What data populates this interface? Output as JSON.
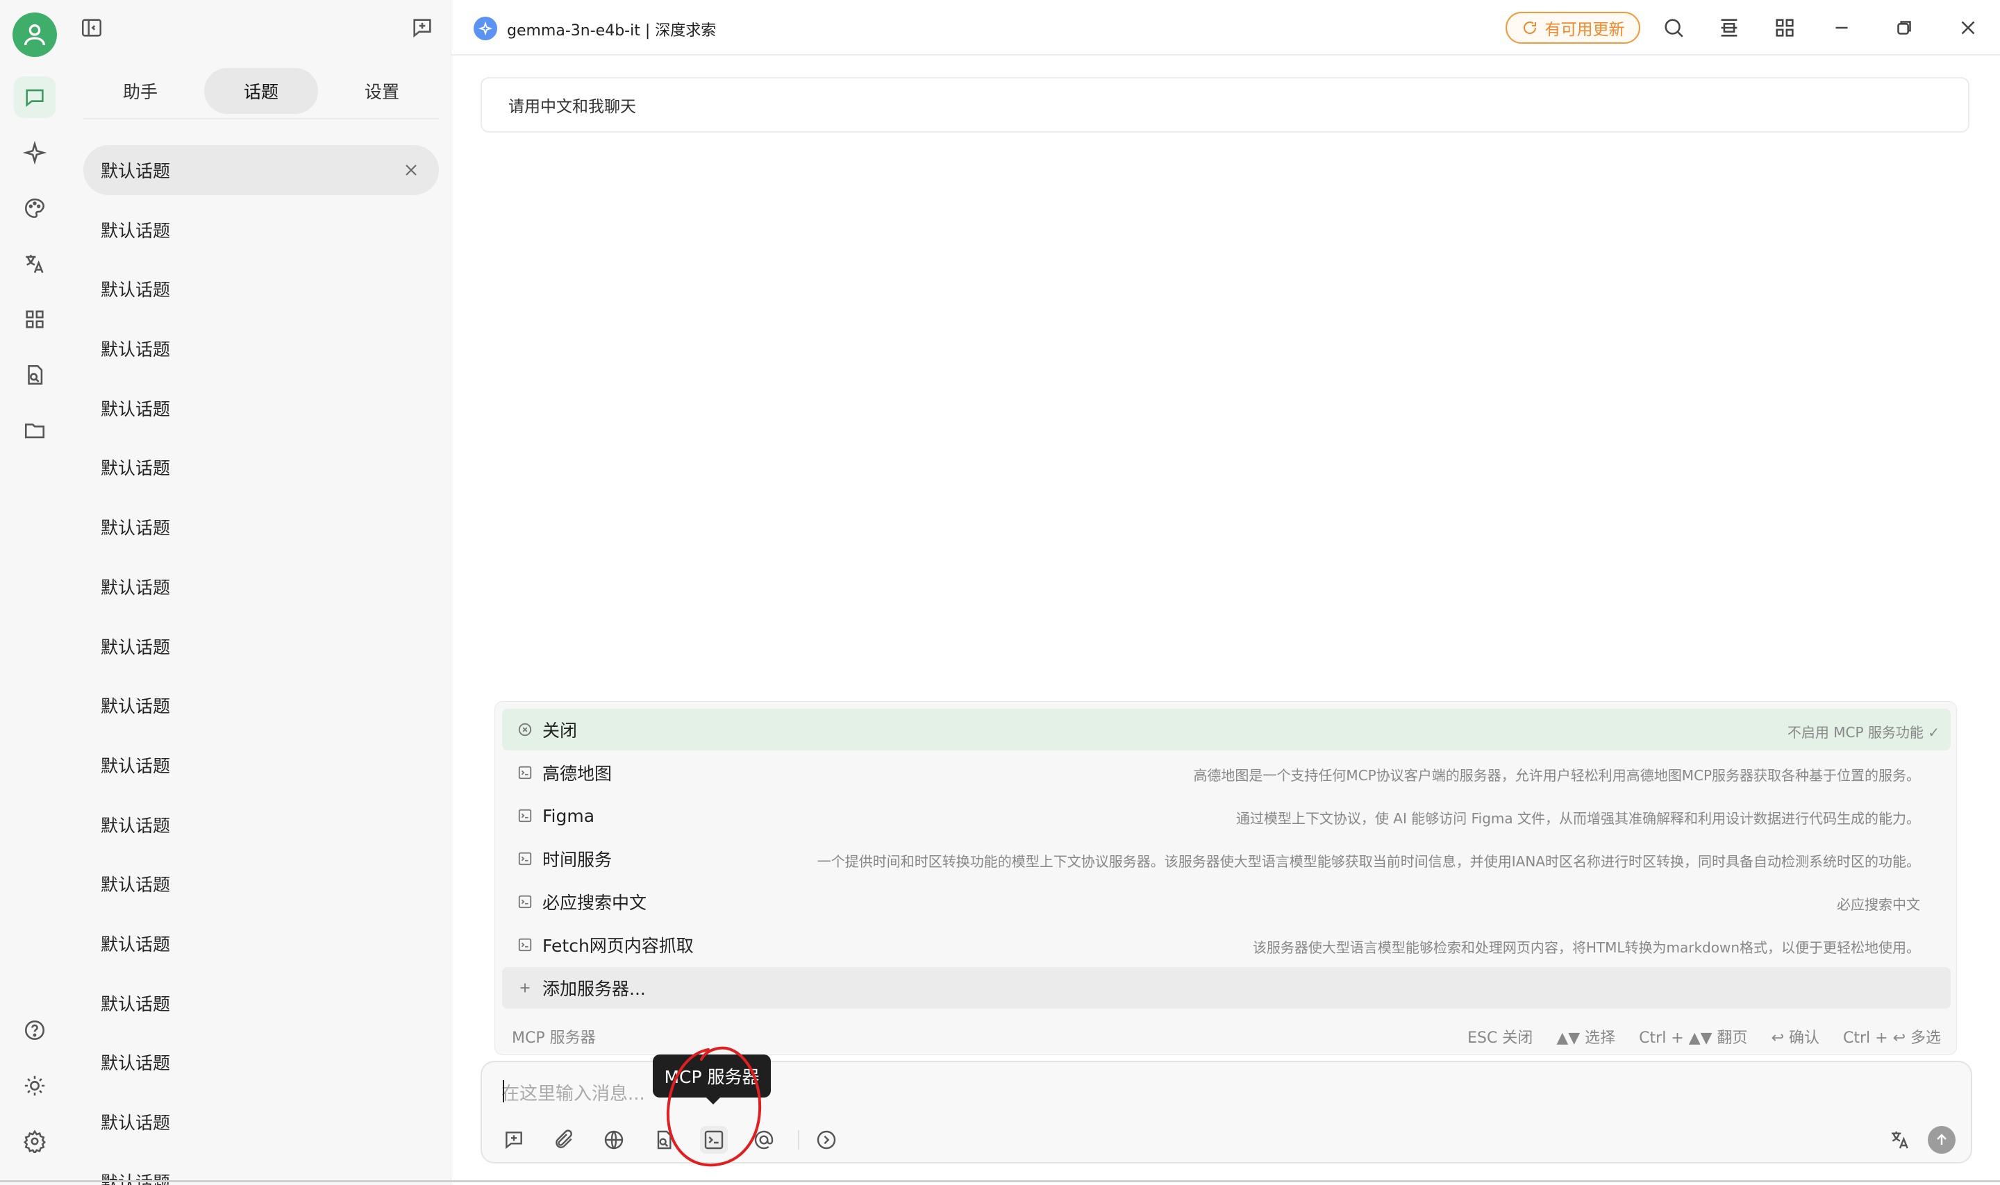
{
  "activity_bar": {
    "items": [
      {
        "icon": "chat-icon",
        "active": true
      },
      {
        "icon": "sparkle-icon"
      },
      {
        "icon": "palette-icon"
      },
      {
        "icon": "translate-icon"
      },
      {
        "icon": "apps-grid-icon"
      },
      {
        "icon": "file-search-icon"
      },
      {
        "icon": "folder-icon"
      }
    ],
    "bottom_items": [
      {
        "icon": "help-icon"
      },
      {
        "icon": "theme-icon"
      },
      {
        "icon": "settings-icon"
      }
    ]
  },
  "sidebar": {
    "tabs": [
      {
        "label": "助手"
      },
      {
        "label": "话题",
        "active": true
      },
      {
        "label": "设置"
      }
    ],
    "topics": [
      "默认话题",
      "默认话题",
      "默认话题",
      "默认话题",
      "默认话题",
      "默认话题",
      "默认话题",
      "默认话题",
      "默认话题",
      "默认话题",
      "默认话题",
      "默认话题",
      "默认话题",
      "默认话题",
      "默认话题",
      "默认话题",
      "默认话题",
      "默认话题"
    ]
  },
  "titlebar": {
    "model_name": "gemma-3n-e4b-it | 深度求索",
    "update_label": "有可用更新"
  },
  "main": {
    "system_prompt": "请用中文和我聊天"
  },
  "mcp_panel": {
    "title": "MCP 服务器",
    "items": [
      {
        "name": "关闭",
        "desc": "不启用 MCP 服务功能 ✓",
        "selected": true,
        "icon": "circle-x-icon"
      },
      {
        "name": "高德地图",
        "desc": "高德地图是一个支持任何MCP协议客户端的服务器，允许用户轻松利用高德地图MCP服务器获取各种基于位置的服务。",
        "icon": "terminal-icon"
      },
      {
        "name": "Figma",
        "desc": "通过模型上下文协议，使 AI 能够访问 Figma 文件，从而增强其准确解释和利用设计数据进行代码生成的能力。",
        "icon": "terminal-icon"
      },
      {
        "name": "时间服务",
        "desc": "一个提供时间和时区转换功能的模型上下文协议服务器。该服务器使大型语言模型能够获取当前时间信息，并使用IANA时区名称进行时区转换，同时具备自动检测系统时区的功能。",
        "icon": "terminal-icon"
      },
      {
        "name": "必应搜索中文",
        "desc": "必应搜索中文",
        "icon": "terminal-icon"
      },
      {
        "name": "Fetch网页内容抓取",
        "desc": "该服务器使大型语言模型能够检索和处理网页内容，将HTML转换为markdown格式，以便于更轻松地使用。",
        "icon": "terminal-icon"
      },
      {
        "name": "添加服务器...",
        "desc": "",
        "add": true,
        "icon": "plus-icon"
      }
    ],
    "hints": [
      "ESC 关闭",
      "▲▼ 选择",
      "Ctrl + ▲▼ 翻页",
      "↩ 确认",
      "Ctrl + ↩ 多选"
    ]
  },
  "input": {
    "placeholder": "在这里输入消息...",
    "tooltip": "MCP 服务器",
    "tools": [
      "new-topic-icon",
      "attachment-icon",
      "web-search-icon",
      "knowledge-base-icon",
      "mcp-server-icon",
      "mention-icon",
      "more-icon"
    ],
    "right_tools": [
      "translate-icon",
      "send-icon"
    ]
  },
  "colors": {
    "accent_green": "#3fae6a",
    "update_orange": "#f0892a",
    "annotation_red": "#e02020"
  }
}
